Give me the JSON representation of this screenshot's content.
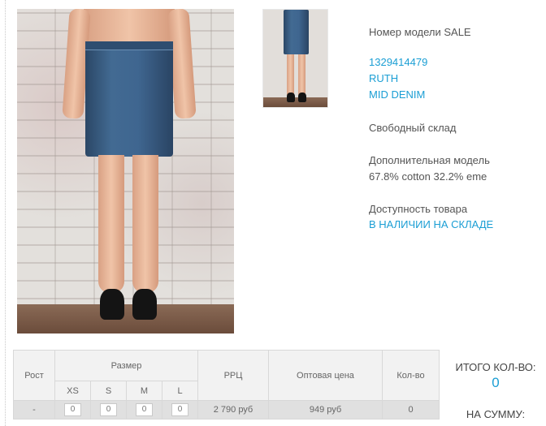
{
  "product": {
    "model_label": "Номер модели SALE",
    "article": "1329414479",
    "name": "RUTH",
    "color": "MID DENIM",
    "warehouse": "Свободный склад",
    "extra_label": "Дополнительная модель",
    "composition": "67.8% cotton 32.2% eme",
    "availability_label": "Доступность товара",
    "availability_status": "В НАЛИЧИИ НА СКЛАДЕ"
  },
  "table": {
    "header_height": "Рост",
    "header_size": "Размер",
    "sizes": [
      "XS",
      "S",
      "M",
      "L"
    ],
    "header_rrp": "РРЦ",
    "header_wholesale": "Оптовая цена",
    "header_qty": "Кол-во",
    "row": {
      "height": "-",
      "quantities": [
        "0",
        "0",
        "0",
        "0"
      ],
      "rrp": "2 790 руб",
      "wholesale": "949 руб",
      "qty": "0"
    }
  },
  "totals": {
    "total_qty_label": "ИТОГО КОЛ-ВО:",
    "total_qty_value": "0",
    "total_sum_label": "НА СУММУ:"
  },
  "colors": {
    "link": "#1a9ed4",
    "denim": "#3f6690"
  }
}
